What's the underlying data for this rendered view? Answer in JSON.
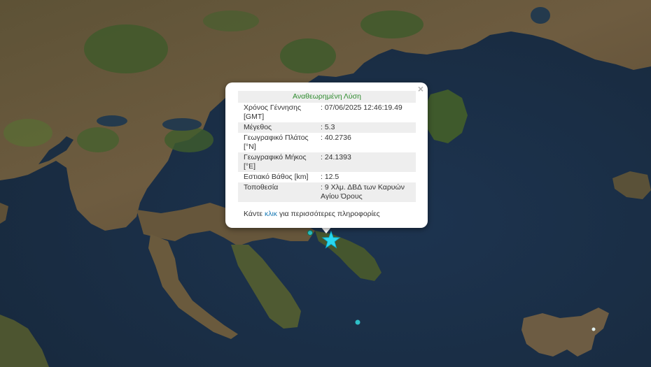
{
  "popup": {
    "title": "Αναθεωρημένη Λύση",
    "close_glyph": "×",
    "rows": [
      {
        "label": "Χρόνος Γέννησης [GMT]",
        "value": ": 07/06/2025 12:46:19.49"
      },
      {
        "label": "Μέγεθος",
        "value": ": 5.3"
      },
      {
        "label": "Γεωγραφικό Πλάτος [°N]",
        "value": ": 40.2736"
      },
      {
        "label": "Γεωγραφικό Μήκος [°E]",
        "value": ": 24.1393"
      },
      {
        "label": "Εστιακό Βάθος [km]",
        "value": ": 12.5"
      },
      {
        "label": "Τοποθεσία",
        "value": ": 9 Χλμ. ΔΒΔ των Καρυών Αγίου Όρους"
      }
    ],
    "more_prefix": "Κάντε ",
    "more_link": "κλικ",
    "more_suffix": " για περισσότερες πληροφορίες"
  },
  "markers": {
    "epicenter_icon": "star-icon",
    "epicenter_color": "#29d8f0",
    "event_color": "#2ec0c8",
    "event_icon": "circle-icon"
  },
  "colors": {
    "sea": "#1c2f45",
    "land": "#6b5a3e",
    "forest": "#3c5a2a",
    "popup_title": "#2e8b2e",
    "link": "#1a7ab5"
  }
}
